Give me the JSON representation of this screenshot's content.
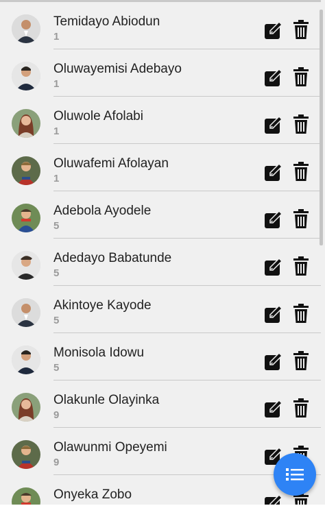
{
  "contacts": [
    {
      "name": "Temidayo Abiodun",
      "count": "1"
    },
    {
      "name": "Oluwayemisi Adebayo",
      "count": "1"
    },
    {
      "name": "Oluwole Afolabi",
      "count": "1"
    },
    {
      "name": "Oluwafemi Afolayan",
      "count": "1"
    },
    {
      "name": "Adebola Ayodele",
      "count": "5"
    },
    {
      "name": "Adedayo Babatunde",
      "count": "5"
    },
    {
      "name": "Akintoye Kayode",
      "count": "5"
    },
    {
      "name": "Monisola Idowu",
      "count": "5"
    },
    {
      "name": "Olakunle Olayinka",
      "count": "9"
    },
    {
      "name": "Olawunmi Opeyemi",
      "count": "9"
    },
    {
      "name": "Onyeka Zobo",
      "count": ""
    }
  ],
  "icons": {
    "edit": "edit-icon",
    "delete": "trash-icon",
    "fab": "list-icon"
  },
  "colors": {
    "accent": "#2e83f5",
    "name_text": "#222222",
    "count_text": "#9a9a9a",
    "background": "#f0f0f0"
  }
}
